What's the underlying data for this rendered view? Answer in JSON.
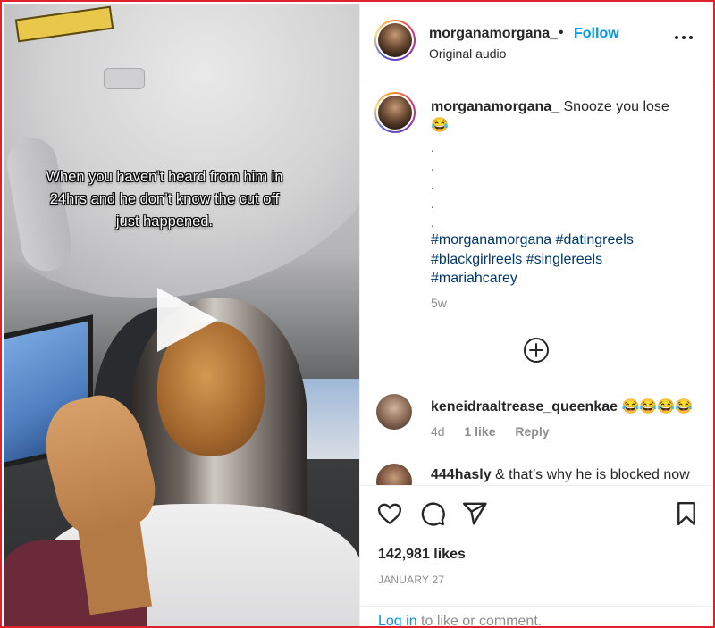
{
  "post": {
    "username": "morganamorgana_",
    "dot": "•",
    "follow_label": "Follow",
    "audio": "Original audio",
    "video_caption": "When you haven’t heard from him in 24hrs and he don’t know the cut off just happened."
  },
  "caption": {
    "username": "morganamorgana_",
    "text": "Snooze you lose",
    "emoji": "😂",
    "dots": [
      ".",
      ".",
      ".",
      ".",
      "."
    ],
    "hashtags": [
      "#morganamorgana",
      "#datingreels",
      "#blackgirlreels",
      "#singlereels",
      "#mariahcarey"
    ],
    "time": "5w"
  },
  "comments": [
    {
      "username": "keneidraaltrease_queenkae",
      "text": "😂😂😂😂",
      "time": "4d",
      "likes": "1 like",
      "reply": "Reply"
    },
    {
      "username": "444hasly",
      "text": "& that’s why he is blocked now"
    }
  ],
  "footer": {
    "likes": "142,981 likes",
    "date": "JANUARY 27",
    "login_link": "Log in",
    "login_rest": "to like or comment."
  },
  "colors": {
    "accent": "#0095f6",
    "hashtag": "#00376b",
    "muted": "#8e8e8e",
    "border": "#e0222f"
  },
  "icons": [
    "play-icon",
    "more-icon",
    "add-circle-icon",
    "heart-icon",
    "comment-icon",
    "share-icon",
    "bookmark-icon"
  ]
}
